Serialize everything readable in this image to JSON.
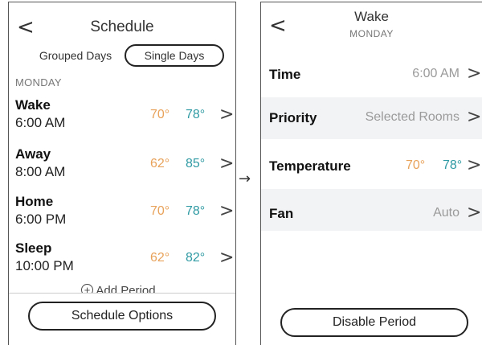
{
  "left": {
    "title": "Schedule",
    "back_glyph": "<",
    "toggle": {
      "grouped": "Grouped Days",
      "single": "Single Days",
      "selected": "Single Days"
    },
    "section_label": "MONDAY",
    "periods": [
      {
        "name": "Wake",
        "time": "6:00 AM",
        "heat": "70°",
        "cool": "78°"
      },
      {
        "name": "Away",
        "time": "8:00 AM",
        "heat": "62°",
        "cool": "85°"
      },
      {
        "name": "Home",
        "time": "6:00 PM",
        "heat": "70°",
        "cool": "78°"
      },
      {
        "name": "Sleep",
        "time": "10:00 PM",
        "heat": "62°",
        "cool": "82°"
      }
    ],
    "add_period": "Add Period",
    "add_icon": "+",
    "button": "Schedule Options"
  },
  "arrow": "→",
  "right": {
    "title": "Wake",
    "subtitle": "MONDAY",
    "back_glyph": "<",
    "rows": {
      "time": {
        "label": "Time",
        "value": "6:00 AM"
      },
      "priority": {
        "label": "Priority",
        "value": "Selected Rooms"
      },
      "temperature": {
        "label": "Temperature",
        "heat": "70°",
        "cool": "78°"
      },
      "fan": {
        "label": "Fan",
        "value": "Auto"
      }
    },
    "button": "Disable Period"
  },
  "chevron": ">",
  "colors": {
    "heat": "#e8a25a",
    "cool": "#2f9aa3",
    "muted": "#9a9a9a",
    "band": "#f2f3f5"
  },
  "icons": {
    "back": "chevron-left-icon",
    "chevron": "chevron-right-icon",
    "add": "plus-circle-icon"
  }
}
